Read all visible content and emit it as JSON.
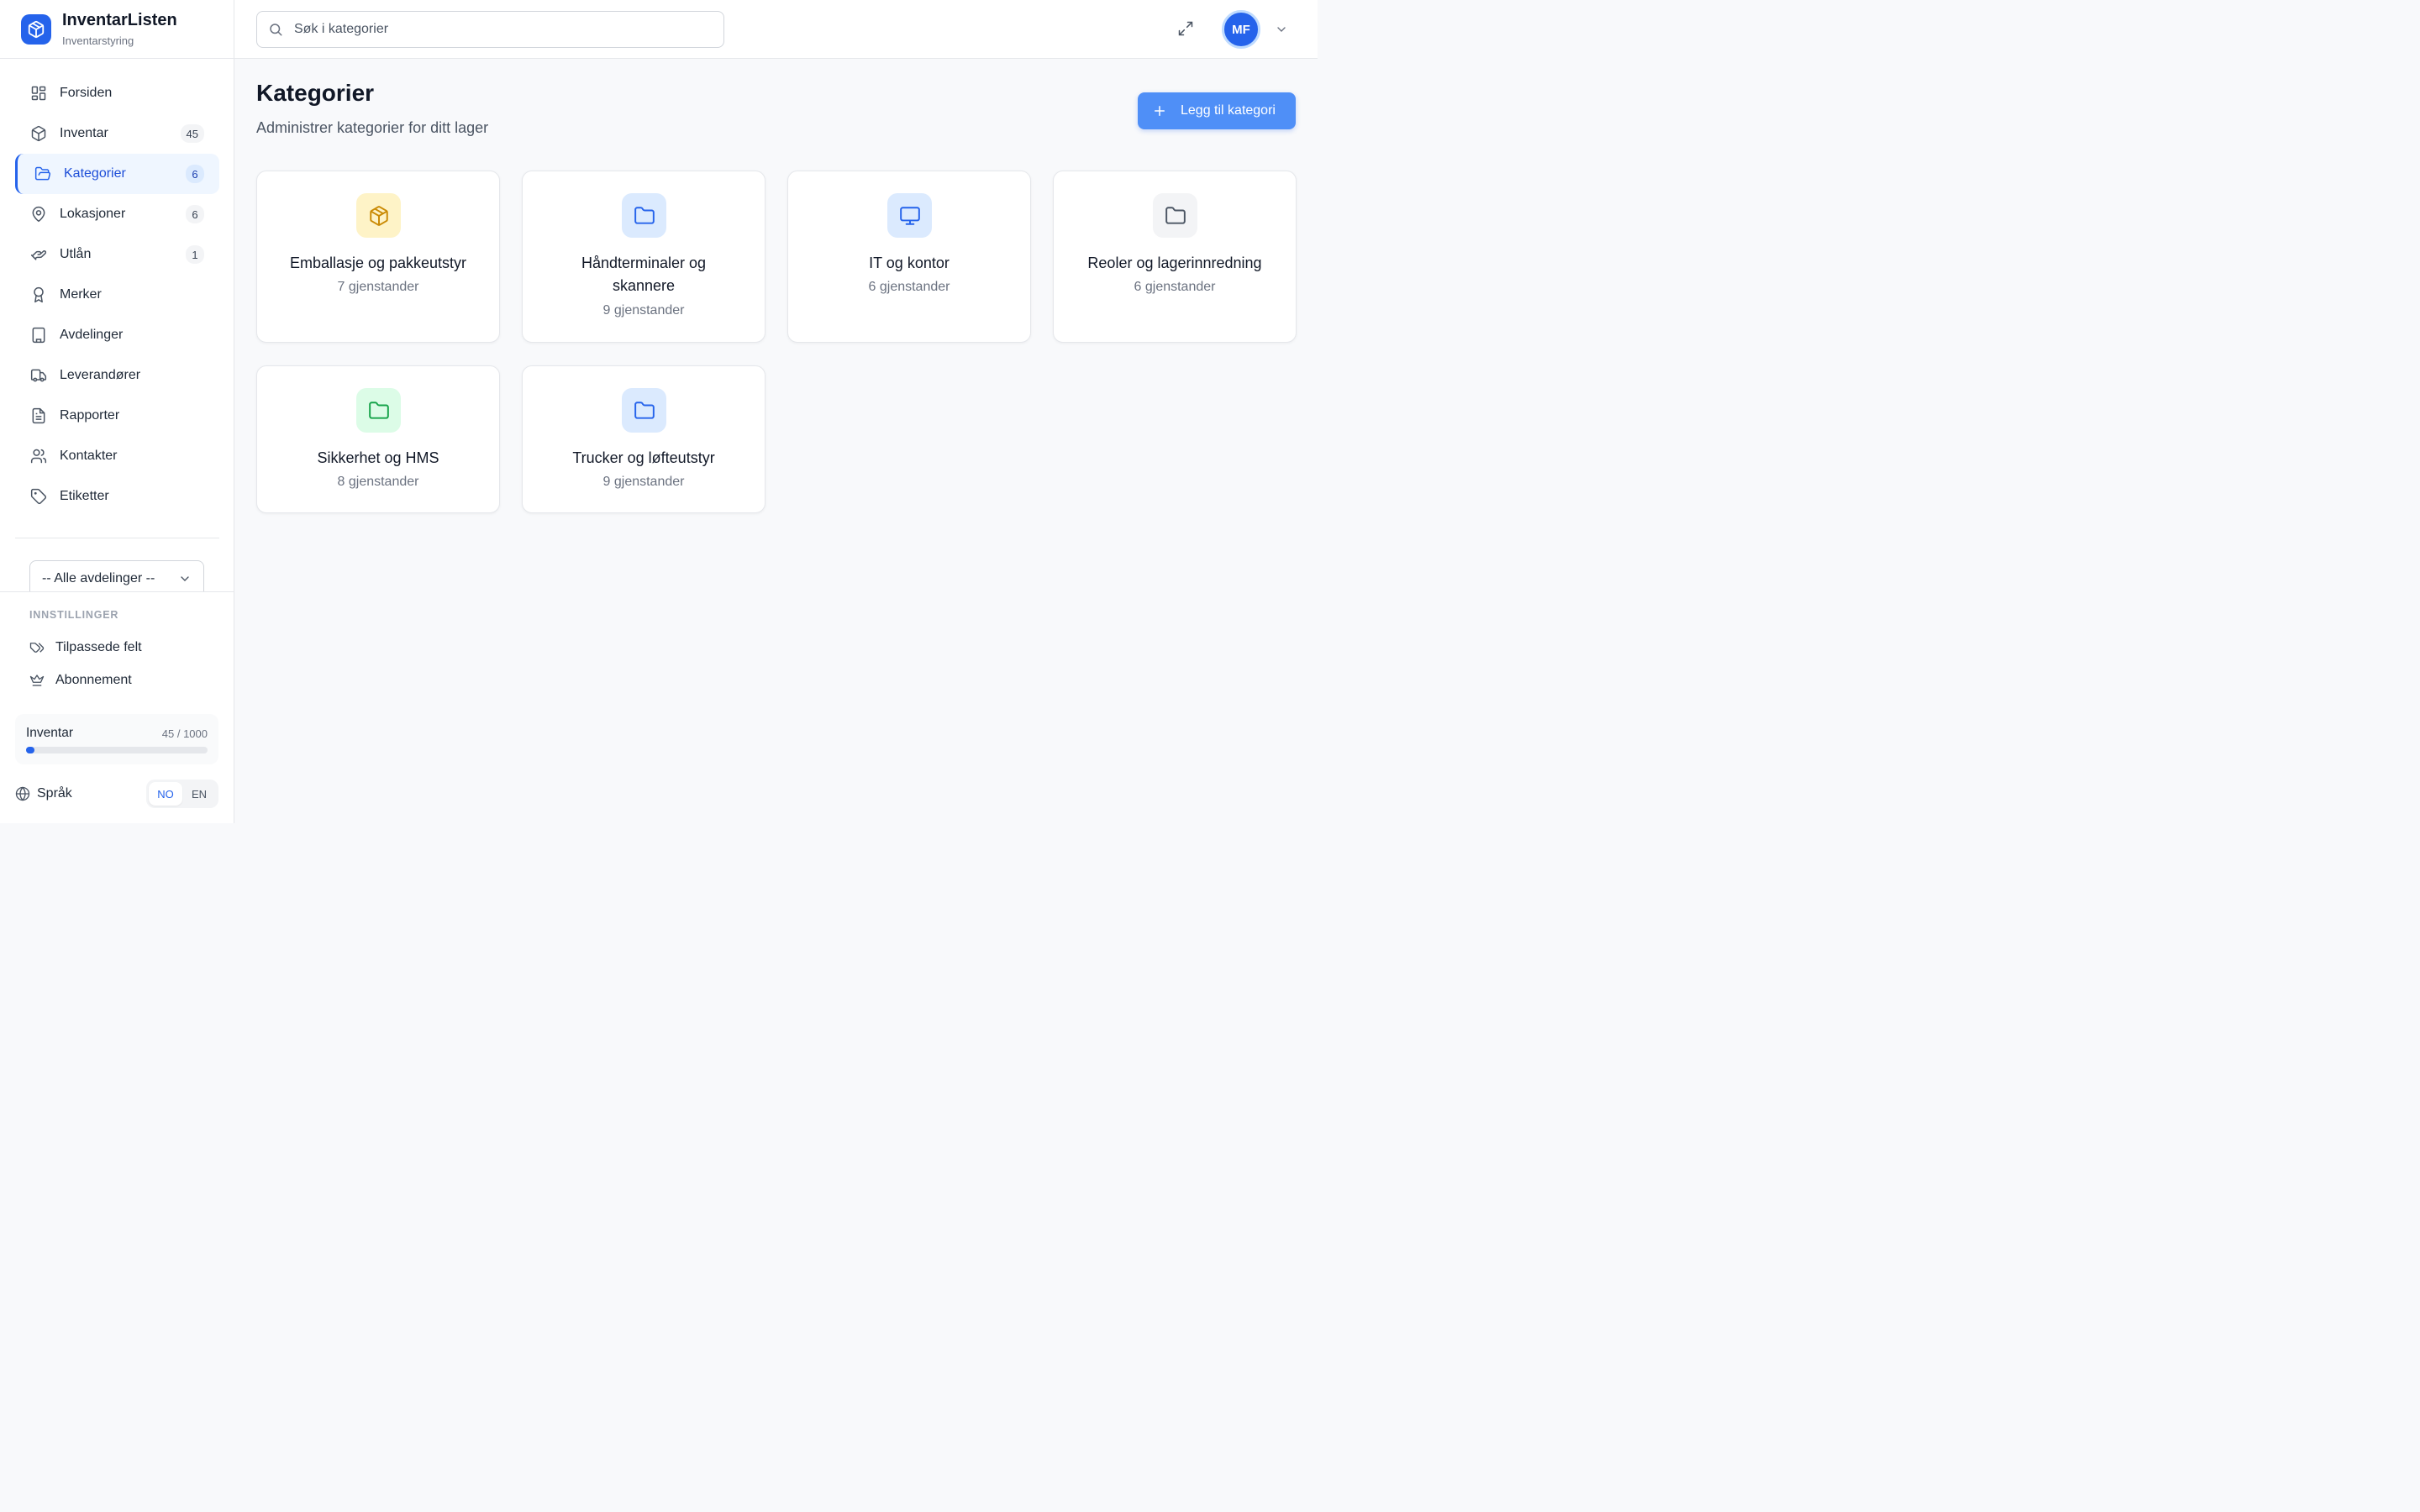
{
  "brand": {
    "title": "InventarListen",
    "subtitle": "Inventarstyring"
  },
  "nav": [
    {
      "label": "Forsiden",
      "icon": "dashboard-icon"
    },
    {
      "label": "Inventar",
      "icon": "box-icon",
      "badge": "45"
    },
    {
      "label": "Kategorier",
      "icon": "folder-open-icon",
      "badge": "6",
      "active": true
    },
    {
      "label": "Lokasjoner",
      "icon": "map-pin-icon",
      "badge": "6"
    },
    {
      "label": "Utlån",
      "icon": "hand-icon",
      "badge": "1"
    },
    {
      "label": "Merker",
      "icon": "award-icon"
    },
    {
      "label": "Avdelinger",
      "icon": "building-icon"
    },
    {
      "label": "Leverandører",
      "icon": "truck-icon"
    },
    {
      "label": "Rapporter",
      "icon": "file-text-icon"
    },
    {
      "label": "Kontakter",
      "icon": "users-icon"
    },
    {
      "label": "Etiketter",
      "icon": "tag-icon"
    }
  ],
  "department_select": {
    "value": "-- Alle avdelinger --"
  },
  "settings": {
    "heading": "INNSTILLINGER",
    "items": [
      {
        "label": "Tilpassede felt",
        "icon": "tags-icon"
      },
      {
        "label": "Abonnement",
        "icon": "crown-icon"
      }
    ]
  },
  "usage": {
    "label": "Inventar",
    "count_text": "45 / 1000",
    "used": 45,
    "limit": 1000
  },
  "language": {
    "label": "Språk",
    "options": [
      "NO",
      "EN"
    ],
    "selected": "NO"
  },
  "topbar": {
    "search_placeholder": "Søk i kategorier",
    "avatar_initials": "MF"
  },
  "page": {
    "title": "Kategorier",
    "subtitle": "Administrer kategorier for ditt lager",
    "add_button": "Legg til kategori"
  },
  "categories": [
    {
      "name": "Emballasje og pakkeutstyr",
      "count": "7 gjenstander",
      "icon": "package-icon",
      "bg": "#fef3c7",
      "fg": "#ca8a04"
    },
    {
      "name": "Håndterminaler og skannere",
      "count": "9 gjenstander",
      "icon": "folder-icon",
      "bg": "#dbeafe",
      "fg": "#2563eb"
    },
    {
      "name": "IT og kontor",
      "count": "6 gjenstander",
      "icon": "monitor-icon",
      "bg": "#dbeafe",
      "fg": "#2563eb"
    },
    {
      "name": "Reoler og lagerinnredning",
      "count": "6 gjenstander",
      "icon": "folder-icon",
      "bg": "#f3f4f6",
      "fg": "#4b5563"
    },
    {
      "name": "Sikkerhet og HMS",
      "count": "8 gjenstander",
      "icon": "folder-icon",
      "bg": "#dcfce7",
      "fg": "#16a34a"
    },
    {
      "name": "Trucker og løfteutstyr",
      "count": "9 gjenstander",
      "icon": "folder-icon",
      "bg": "#dbeafe",
      "fg": "#2563eb"
    }
  ]
}
